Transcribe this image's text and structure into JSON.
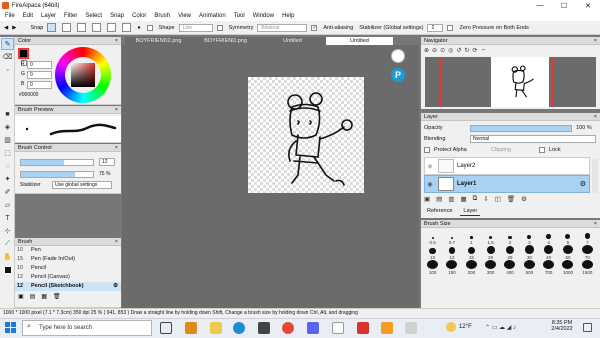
{
  "window": {
    "title": "FireAlpaca (64bit)",
    "minimize": "—",
    "maximize": "☐",
    "close": "✕"
  },
  "menu": [
    "File",
    "Edit",
    "Layer",
    "Filter",
    "Select",
    "Snap",
    "Color",
    "Brush",
    "View",
    "Animation",
    "Tool",
    "Window",
    "Help"
  ],
  "toolbar": {
    "snap": "Snap",
    "shape": "Shape",
    "shape_value": "Line",
    "symmetry": "Symmetry",
    "symmetry_value": "Bilateral",
    "antialiasing": "Anti-aliasing",
    "stabilizer": "Stabilizer (Global settings)",
    "stabilizer_value": "2",
    "zero_pressure": "Zero Pressure on Both Ends"
  },
  "tabs": [
    "BOYFRIEND2.png",
    "BOYFRIEND.png",
    "Untitled",
    "Untitled"
  ],
  "color_panel": {
    "title": "Color",
    "r_label": "R",
    "g_label": "G",
    "b_label": "B",
    "r": "0",
    "g": "0",
    "b": "0",
    "hex": "#000000"
  },
  "brush_preview": {
    "title": "Brush Preview"
  },
  "brush_control": {
    "title": "Brush Control",
    "size": "12",
    "opacity": "75 %",
    "opacity_value": 75,
    "stabilizer_label": "Stabilizer",
    "stabilizer_value": "Use global settings"
  },
  "brush_list": {
    "title": "Brush",
    "items": [
      {
        "size": "10",
        "name": "Pen"
      },
      {
        "size": "15",
        "name": "Pen (Fade In/Out)"
      },
      {
        "size": "10",
        "name": "Pencil"
      },
      {
        "size": "12",
        "name": "Pencil (Canvas)"
      },
      {
        "size": "12",
        "name": "Pencil (Sketchbook)"
      }
    ]
  },
  "navigator": {
    "title": "Navigator"
  },
  "layer_panel": {
    "title": "Layer",
    "opacity_label": "Opacity",
    "opacity": "100 %",
    "blending_label": "Blending",
    "blending": "Normal",
    "protect_alpha": "Protect Alpha",
    "clipping": "Clipping",
    "lock": "Lock",
    "layers": [
      "Layer2",
      "Layer1"
    ]
  },
  "sub_tabs": [
    "Reference",
    "Layer"
  ],
  "brush_size": {
    "title": "Brush Size",
    "sizes": [
      "0.5",
      "0.7",
      "1",
      "1.5",
      "2",
      "3",
      "4",
      "5",
      "7",
      "10",
      "12",
      "15",
      "20",
      "25",
      "30",
      "40",
      "50",
      "70",
      "100",
      "150",
      "200",
      "300",
      "400",
      "500",
      "700",
      "1000",
      "1500"
    ]
  },
  "status": "1000 * 1000 pixel  (7.1 * 7.3cm)  350 dpi  25 %  ( 941, 853 )  Draw a straight line by holding down Shift, Change a brush size by holding down Ctrl, Alt, and dragging",
  "taskbar": {
    "search": "Type here to search",
    "weather": "12°F",
    "time": "8:35 PM",
    "date": "2/4/2022"
  }
}
